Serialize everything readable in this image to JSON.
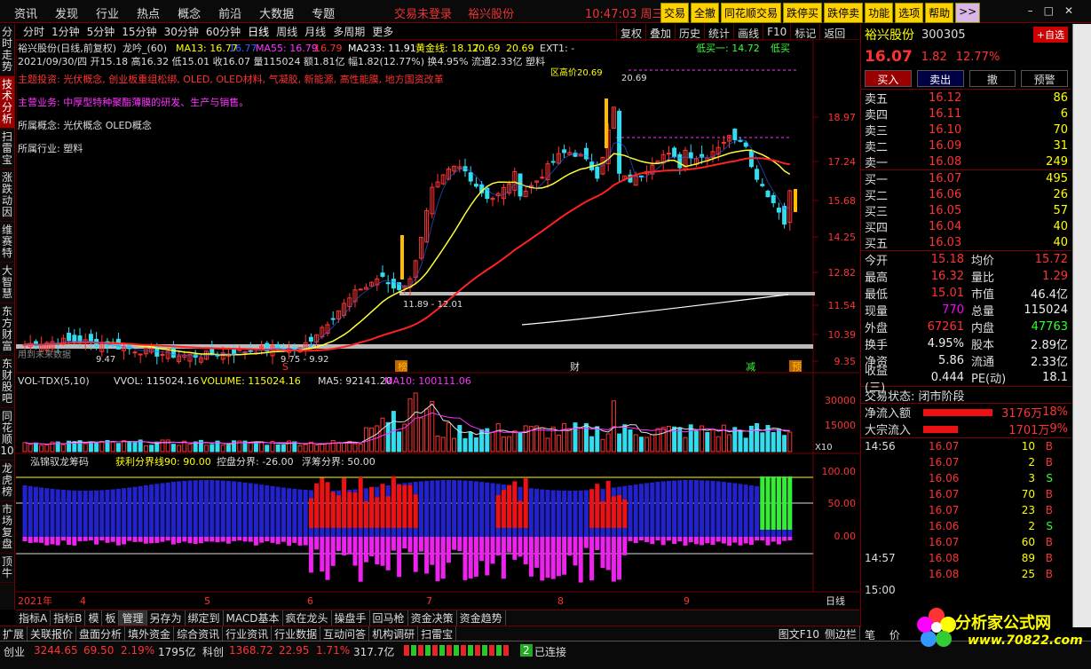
{
  "topbar": {
    "menu": [
      "资讯",
      "发现",
      "行业",
      "热点",
      "概念",
      "前沿",
      "大数据",
      "专题"
    ],
    "login": "交易未登录",
    "stock": "裕兴股份",
    "time": "10:47:03",
    "weekday": "周三",
    "buttons": [
      "交易",
      "全撤",
      "同花顺交易",
      "跌停买",
      "跌停卖",
      "功能",
      "选项",
      "帮助",
      ">>"
    ]
  },
  "leftnav": [
    "分时走势",
    "技术分析",
    "扫雷宝",
    "涨跌动因",
    "维赛特",
    "大智慧",
    "东方财富",
    "东财股吧",
    "同花顺10",
    "龙虎榜",
    "市场复盘",
    "顶牛"
  ],
  "periods": [
    "分时",
    "1分钟",
    "5分钟",
    "15分钟",
    "30分钟",
    "60分钟",
    "日线",
    "周线",
    "月线",
    "多周期",
    "更多"
  ],
  "period_selected": "日线",
  "chart_buttons": [
    "复权",
    "叠加",
    "历史",
    "统计",
    "画线",
    "F10",
    "标记",
    "返回"
  ],
  "main_chart": {
    "title": "裕兴股份(日线,前复权)",
    "indicator": "龙吟_(60)",
    "ma13": "MA13: 16.77",
    "ma13b": "16.77",
    "ma55": "MA55: 16.79",
    "ma55b": "16.79",
    "ma233": "MA233: 11.91",
    "golden": "黄金线: 18.17",
    "g2": "20.69",
    "g3": "20.69",
    "ext": "EXT1: -",
    "low_buy": "低买一: 14.72",
    "low_buy2": "低买",
    "info_line": "2021/09/30/四 开15.18 高16.32 低15.01 收16.07 量115024 额1.81亿 幅1.82(12.77%) 换4.95% 流通2.33亿 塑料",
    "investment": "主题投资: 光伏概念, 创业板重组松绑, OLED, OLED材料, 气凝胶, 新能源, 高性能膜, 地方国资改革",
    "business": "主营业务: 中厚型特种聚酯薄膜的研发、生产与销售。",
    "concept": "所属概念: 光伏概念 OLED概念",
    "industry": "所属行业: 塑料",
    "high_label": "20.69",
    "high_tag": "区高价20.69",
    "range1": "11.89 - 12.01",
    "range2": "9.75 - 9.92",
    "low_label": "9.47",
    "future": "用到未来数据",
    "markers": [
      "S",
      "榜",
      "财",
      "减",
      "预"
    ],
    "yaxis": [
      "18.97",
      "17.24",
      "15.68",
      "14.25",
      "12.82",
      "11.54",
      "10.39",
      "9.35"
    ]
  },
  "volume_chart": {
    "title": "VOL-TDX(5,10)",
    "vvol": "VVOL: 115024.16",
    "volume": "VOLUME: 115024.16",
    "ma5": "MA5: 92141.20",
    "ma10": "MA10: 100111.06",
    "yaxis": [
      "30000",
      "15000"
    ],
    "unit": "X10"
  },
  "chip_chart": {
    "title": "泓锦驭龙筹码",
    "profit": "获利分界线90: 90.00",
    "control": "控盘分界: -26.00",
    "float": "浮筹分界: 50.00",
    "yaxis": [
      "100.00",
      "50.00",
      "0.00"
    ]
  },
  "xaxis": [
    "2021年",
    "4",
    "5",
    "6",
    "7",
    "8",
    "9"
  ],
  "xaxis_mode": "日线",
  "bottom_tabs1": [
    "指标A",
    "指标B",
    "模",
    "板",
    "管理",
    "另存为",
    "绑定到",
    "MACD基本",
    "疯在龙头",
    "操盘手",
    "回马枪",
    "资金决策",
    "资金趋势"
  ],
  "bottom_tabs2": [
    "扩展",
    "关联报价",
    "盘面分析",
    "填外资金",
    "综合资讯",
    "行业资讯",
    "行业数据",
    "互动问答",
    "机构调研",
    "扫雷宝"
  ],
  "bottom_right": [
    "图文F10",
    "侧边栏"
  ],
  "quote": {
    "name": "裕兴股份",
    "code": "300305",
    "add": "+自选",
    "price": "16.07",
    "change": "1.82",
    "pct": "12.77%",
    "actions": [
      "买入",
      "卖出",
      "撤",
      "预警"
    ],
    "asks": [
      {
        "l": "卖五",
        "p": "16.12",
        "v": "86"
      },
      {
        "l": "卖四",
        "p": "16.11",
        "v": "6"
      },
      {
        "l": "卖三",
        "p": "16.10",
        "v": "70"
      },
      {
        "l": "卖二",
        "p": "16.09",
        "v": "31"
      },
      {
        "l": "卖一",
        "p": "16.08",
        "v": "249"
      }
    ],
    "bids": [
      {
        "l": "买一",
        "p": "16.07",
        "v": "495"
      },
      {
        "l": "买二",
        "p": "16.06",
        "v": "26"
      },
      {
        "l": "买三",
        "p": "16.05",
        "v": "57"
      },
      {
        "l": "买四",
        "p": "16.04",
        "v": "40"
      },
      {
        "l": "买五",
        "p": "16.03",
        "v": "40"
      }
    ],
    "stats": [
      {
        "l1": "今开",
        "v1": "15.18",
        "c1": "red",
        "l2": "均价",
        "v2": "15.72",
        "c2": "red"
      },
      {
        "l1": "最高",
        "v1": "16.32",
        "c1": "red",
        "l2": "量比",
        "v2": "1.29",
        "c2": "red"
      },
      {
        "l1": "最低",
        "v1": "15.01",
        "c1": "red",
        "l2": "市值",
        "v2": "46.4亿",
        "c2": "wht"
      },
      {
        "l1": "现量",
        "v1": "770",
        "c1": "mag",
        "l2": "总量",
        "v2": "115024",
        "c2": "wht"
      },
      {
        "l1": "外盘",
        "v1": "67261",
        "c1": "red",
        "l2": "内盘",
        "v2": "47763",
        "c2": "grn"
      },
      {
        "l1": "换手",
        "v1": "4.95%",
        "c1": "wht",
        "l2": "股本",
        "v2": "2.89亿",
        "c2": "wht"
      },
      {
        "l1": "净资",
        "v1": "5.86",
        "c1": "wht",
        "l2": "流通",
        "v2": "2.33亿",
        "c2": "wht"
      },
      {
        "l1": "收益(三)",
        "v1": "0.444",
        "c1": "wht",
        "l2": "PE(动)",
        "v2": "18.1",
        "c2": "wht"
      }
    ],
    "trade_state": "交易状态: 闭市阶段",
    "flows": [
      {
        "l": "净流入额",
        "v": "3176万",
        "pc": "18%"
      },
      {
        "l": "大宗流入",
        "v": "1701万",
        "pc": "9%"
      }
    ],
    "ticks": [
      {
        "t": "14:56",
        "p": "16.07",
        "v": "10",
        "d": "B"
      },
      {
        "t": "",
        "p": "16.07",
        "v": "2",
        "d": "B"
      },
      {
        "t": "",
        "p": "16.06",
        "v": "3",
        "d": "S"
      },
      {
        "t": "",
        "p": "16.07",
        "v": "70",
        "d": "B"
      },
      {
        "t": "",
        "p": "16.07",
        "v": "23",
        "d": "B"
      },
      {
        "t": "",
        "p": "16.06",
        "v": "2",
        "d": "S"
      },
      {
        "t": "",
        "p": "16.07",
        "v": "60",
        "d": "B"
      },
      {
        "t": "14:57",
        "p": "16.08",
        "v": "89",
        "d": "B"
      },
      {
        "t": "",
        "p": "16.08",
        "v": "25",
        "d": "B"
      },
      {
        "t": "15:00",
        "p": "",
        "v": "",
        "d": ""
      }
    ]
  },
  "status": {
    "idx1_name": "创业",
    "idx1_val": "3244.65",
    "idx1_chg": "69.50",
    "idx1_pct": "2.19%",
    "idx1_amt": "1795亿",
    "idx2_name": "科创",
    "idx2_val": "1368.72",
    "idx2_chg": "22.95",
    "idx2_pct": "1.71%",
    "idx2_amt": "317.7亿",
    "conn": "已连接",
    "conn_num": "2"
  },
  "logo": {
    "t1": "分析家公式网",
    "t2": "www.70822.com"
  },
  "bottom_corner": [
    "笔",
    "价"
  ],
  "colors": {
    "up": "#ff3333",
    "down": "#33ddee",
    "ma13": "#ffff33",
    "ma55": "#ff2222",
    "ma233": "#ffffff"
  }
}
